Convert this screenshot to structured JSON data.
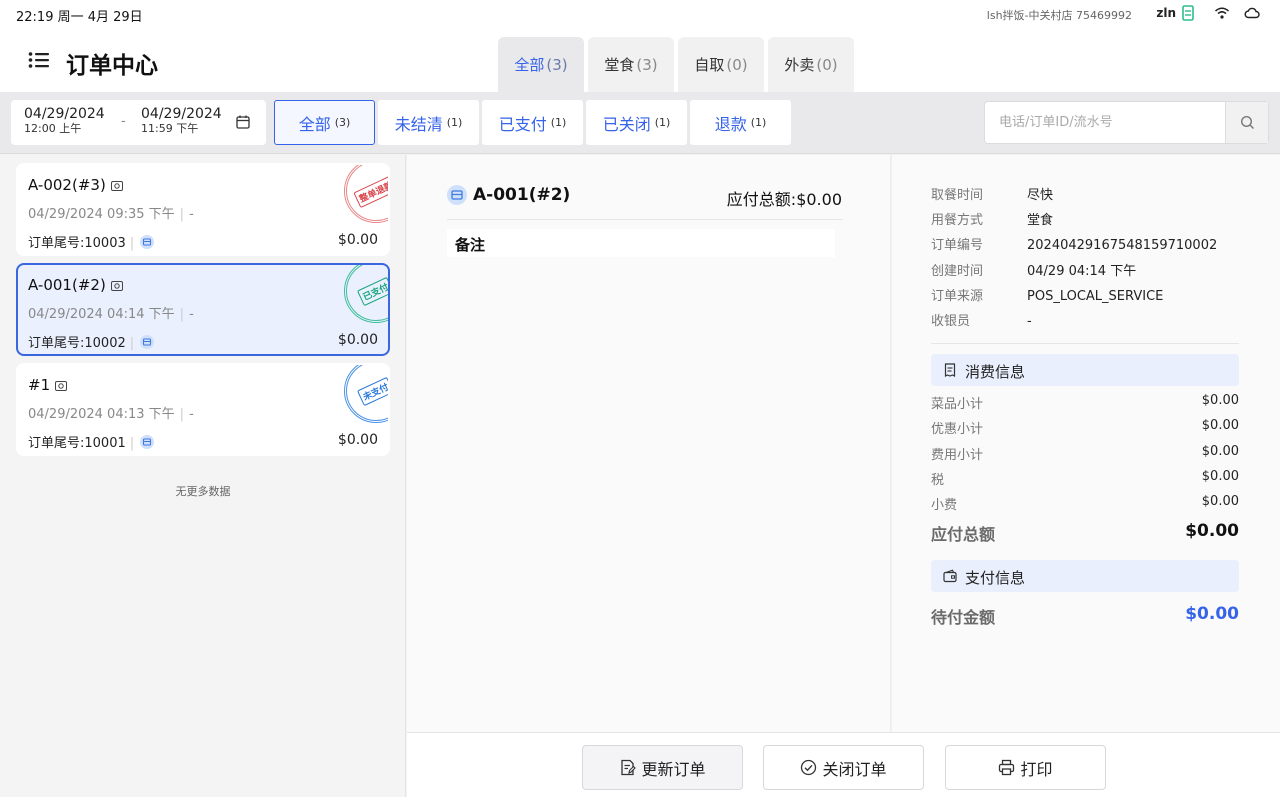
{
  "status_bar": {
    "time": "22:19 周一 4月 29日",
    "store": "lsh拌饭-中关村店  75469992",
    "user": "zln"
  },
  "header": {
    "title": "订单中心",
    "type_tabs": [
      {
        "label": "全部",
        "count": "(3)"
      },
      {
        "label": "堂食",
        "count": "(3)"
      },
      {
        "label": "自取",
        "count": "(0)"
      },
      {
        "label": "外卖",
        "count": "(0)"
      }
    ]
  },
  "filter": {
    "start_date": "04/29/2024",
    "start_time": "12:00 上午",
    "end_date": "04/29/2024",
    "end_time": "11:59 下午",
    "separator": "-",
    "status_tabs": [
      {
        "label": "全部",
        "count": "(3)"
      },
      {
        "label": "未结清",
        "count": "(1)"
      },
      {
        "label": "已支付",
        "count": "(1)"
      },
      {
        "label": "已关闭",
        "count": "(1)"
      },
      {
        "label": "退款",
        "count": "(1)"
      }
    ],
    "search_placeholder": "电话/订单ID/流水号"
  },
  "orders": [
    {
      "name": "A-002(#3)",
      "time": "04/29/2024 09:35 下午",
      "dash": "-",
      "tail": "订单尾号:10003",
      "amount": "$0.00",
      "stamp": "整单退款",
      "stamp_color": "#d9454a"
    },
    {
      "name": "A-001(#2)",
      "time": "04/29/2024 04:14 下午",
      "dash": "-",
      "tail": "订单尾号:10002",
      "amount": "$0.00",
      "stamp": "已支付",
      "stamp_color": "#17a67a"
    },
    {
      "name": "#1",
      "time": "04/29/2024 04:13 下午",
      "dash": "-",
      "tail": "订单尾号:10001",
      "amount": "$0.00",
      "stamp": "未支付",
      "stamp_color": "#2a78d8"
    }
  ],
  "no_more": "无更多数据",
  "detail": {
    "name": "A-001(#2)",
    "total": "应付总额:$0.00",
    "remark_label": "备注"
  },
  "info": {
    "fields": [
      {
        "k": "取餐时间",
        "v": "尽快"
      },
      {
        "k": "用餐方式",
        "v": "堂食"
      },
      {
        "k": "订单编号",
        "v": "20240429167548159710002"
      },
      {
        "k": "创建时间",
        "v": "04/29 04:14 下午"
      },
      {
        "k": "订单来源",
        "v": "POS_LOCAL_SERVICE"
      },
      {
        "k": "收银员",
        "v": "-"
      }
    ],
    "consumption_title": "消费信息",
    "consumption": [
      {
        "k": "菜品小计",
        "v": "$0.00"
      },
      {
        "k": "优惠小计",
        "v": "$0.00"
      },
      {
        "k": "费用小计",
        "v": "$0.00"
      },
      {
        "k": "税",
        "v": "$0.00"
      },
      {
        "k": "小费",
        "v": "$0.00"
      }
    ],
    "payable_label": "应付总额",
    "payable_value": "$0.00",
    "payment_title": "支付信息",
    "pending_label": "待付金额",
    "pending_value": "$0.00"
  },
  "actions": {
    "update": "更新订单",
    "close": "关闭订单",
    "print": "打印"
  },
  "colors": {
    "accent": "#3563e9",
    "selected_bg": "#ebf0ff"
  }
}
